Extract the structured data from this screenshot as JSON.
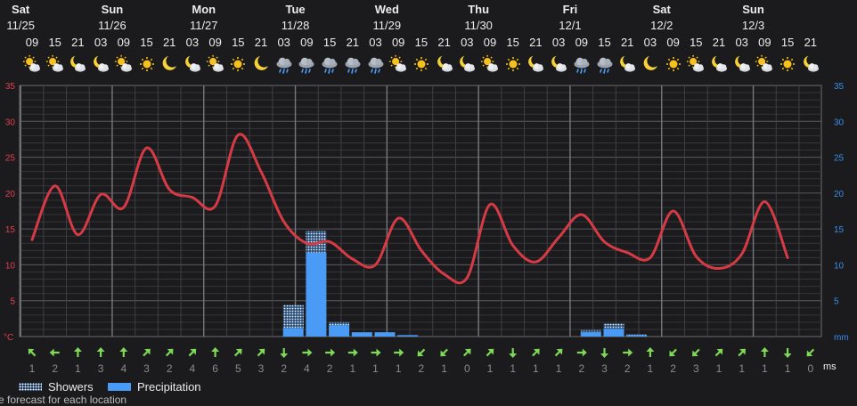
{
  "days": [
    {
      "name": "Sat",
      "date": "11/25"
    },
    {
      "name": "Sun",
      "date": "11/26"
    },
    {
      "name": "Mon",
      "date": "11/27"
    },
    {
      "name": "Tue",
      "date": "11/28"
    },
    {
      "name": "Wed",
      "date": "11/29"
    },
    {
      "name": "Thu",
      "date": "11/30"
    },
    {
      "name": "Fri",
      "date": "12/1"
    },
    {
      "name": "Sat",
      "date": "12/2"
    },
    {
      "name": "Sun",
      "date": "12/3"
    }
  ],
  "hours": [
    "09",
    "15",
    "21",
    "03",
    "09",
    "15",
    "21",
    "03",
    "09",
    "15",
    "21",
    "03",
    "09",
    "15",
    "21",
    "03",
    "09",
    "15",
    "21",
    "03",
    "09",
    "15",
    "21",
    "03",
    "09",
    "15",
    "21",
    "03",
    "09",
    "15",
    "21",
    "03",
    "09",
    "15",
    "21"
  ],
  "weather_icons": [
    "sun-cloud",
    "sun-cloud",
    "moon-cloud",
    "moon-cloud",
    "sun-cloud",
    "sun",
    "moon",
    "moon-cloud",
    "sun-cloud",
    "sun",
    "moon",
    "cloud-rain",
    "cloud-rain",
    "cloud-rain",
    "cloud-rain",
    "cloud-rain",
    "sun-cloud",
    "sun",
    "moon-cloud",
    "moon-cloud",
    "sun-cloud",
    "sun",
    "moon-cloud",
    "moon-cloud",
    "cloud-rain",
    "cloud-rain",
    "moon-cloud",
    "moon",
    "sun",
    "sun-cloud",
    "moon-cloud",
    "moon-cloud",
    "sun-cloud",
    "sun",
    "moon-cloud"
  ],
  "colors": {
    "background": "#1b1b1d",
    "temperature_line": "#d63a45",
    "temp_axis": "#e04050",
    "precip_axis": "#3a8ee6",
    "precipitation": "#4a9bf5",
    "wind_arrow": "#7ed957"
  },
  "legend": {
    "showers": "Showers",
    "precipitation": "Precipitation"
  },
  "wind_unit": "ms",
  "caption_text": "ite forecast for each location",
  "chart_data": {
    "type": "line",
    "x": [
      "11/25 09",
      "11/25 15",
      "11/25 21",
      "11/26 03",
      "11/26 09",
      "11/26 15",
      "11/26 21",
      "11/27 03",
      "11/27 09",
      "11/27 15",
      "11/27 21",
      "11/28 03",
      "11/28 09",
      "11/28 15",
      "11/28 21",
      "11/29 03",
      "11/29 09",
      "11/29 15",
      "11/29 21",
      "11/30 03",
      "11/30 09",
      "11/30 15",
      "11/30 21",
      "12/1 03",
      "12/1 09",
      "12/1 15",
      "12/1 21",
      "12/2 03",
      "12/2 09",
      "12/2 15",
      "12/2 21",
      "12/3 03",
      "12/3 09",
      "12/3 15",
      "12/3 21"
    ],
    "series": [
      {
        "name": "temperature",
        "unit": "°C",
        "values": [
          13.5,
          21,
          14.2,
          19.8,
          18,
          26.3,
          20.5,
          19.4,
          18.2,
          28.1,
          23,
          16,
          13,
          13.2,
          10.8,
          10,
          16.5,
          12,
          8.7,
          8.2,
          18.4,
          12.7,
          10.4,
          13.8,
          17,
          13.2,
          11.7,
          11,
          17.5,
          11.2,
          9.5,
          11.5,
          18.8,
          11
        ]
      },
      {
        "name": "Showers",
        "unit": "mm",
        "values": [
          0,
          0,
          0,
          0,
          0,
          0,
          0,
          0,
          0,
          0,
          0,
          3.2,
          3.0,
          0.4,
          0,
          0,
          0,
          0,
          0,
          0,
          0,
          0,
          0,
          0,
          0.3,
          0.7,
          0.1,
          0,
          0,
          0,
          0,
          0,
          0,
          0
        ]
      },
      {
        "name": "Precipitation",
        "unit": "mm",
        "values": [
          0,
          0,
          0,
          0,
          0,
          0,
          0,
          0,
          0,
          0,
          0,
          1.2,
          11.7,
          1.6,
          0.6,
          0.6,
          0.2,
          0,
          0,
          0,
          0,
          0,
          0,
          0,
          0.6,
          1.1,
          0.2,
          0,
          0,
          0,
          0,
          0,
          0,
          0
        ]
      }
    ],
    "wind": {
      "unit": "ms",
      "speed": [
        1,
        2,
        1,
        3,
        4,
        3,
        2,
        4,
        6,
        5,
        3,
        2,
        4,
        2,
        1,
        1,
        1,
        2,
        1,
        0,
        1,
        1,
        1,
        1,
        2,
        3,
        2,
        1,
        2,
        3,
        1,
        1,
        1,
        1,
        0
      ],
      "direction_deg": [
        315,
        270,
        0,
        0,
        0,
        45,
        45,
        45,
        0,
        45,
        45,
        180,
        90,
        90,
        90,
        90,
        90,
        225,
        225,
        45,
        45,
        180,
        45,
        45,
        90,
        180,
        90,
        0,
        225,
        225,
        45,
        45,
        0,
        180,
        225
      ]
    },
    "ylim": [
      0,
      35
    ],
    "y_ticks": [
      5,
      10,
      15,
      20,
      25,
      30,
      35
    ],
    "y_left_unit": "°C",
    "y_right_unit": "mm",
    "grid": true,
    "legend_position": "bottom-left"
  }
}
